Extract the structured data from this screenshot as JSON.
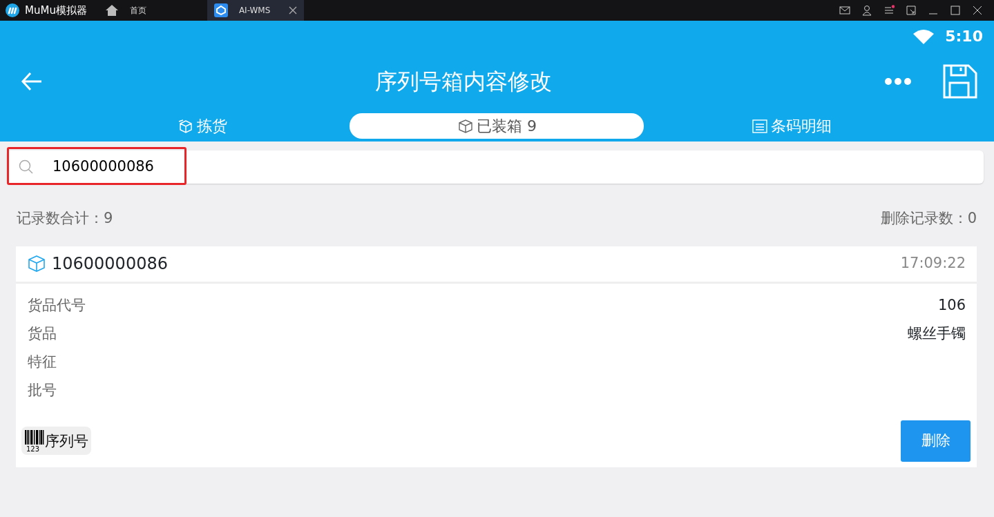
{
  "window": {
    "app_name": "MuMu模拟器",
    "tabs": [
      {
        "label": "首页",
        "kind": "home",
        "selected": false
      },
      {
        "label": "AI-WMS",
        "kind": "app",
        "selected": true
      }
    ]
  },
  "status_bar": {
    "time": "5:10"
  },
  "toolbar": {
    "title": "序列号箱内容修改"
  },
  "tabs": [
    {
      "label": "拣货",
      "kind": "pick",
      "selected": false
    },
    {
      "label": "已装箱 9",
      "kind": "box",
      "selected": true
    },
    {
      "label": "条码明细",
      "kind": "list",
      "selected": false
    }
  ],
  "search": {
    "value": "10600000086",
    "highlighted": true
  },
  "summary": {
    "total": "记录数合计：9",
    "deleted": "删除记录数：0"
  },
  "records": [
    {
      "code": "10600000086",
      "time": "17:09:22",
      "fields": [
        {
          "label": "货品代号",
          "value": "106"
        },
        {
          "label": "货品",
          "value": "螺丝手镯"
        },
        {
          "label": "特征"
        },
        {
          "label": "批号"
        }
      ],
      "serial_label": "序列号",
      "barcode_digits": "123",
      "delete_label": "删除"
    }
  ]
}
